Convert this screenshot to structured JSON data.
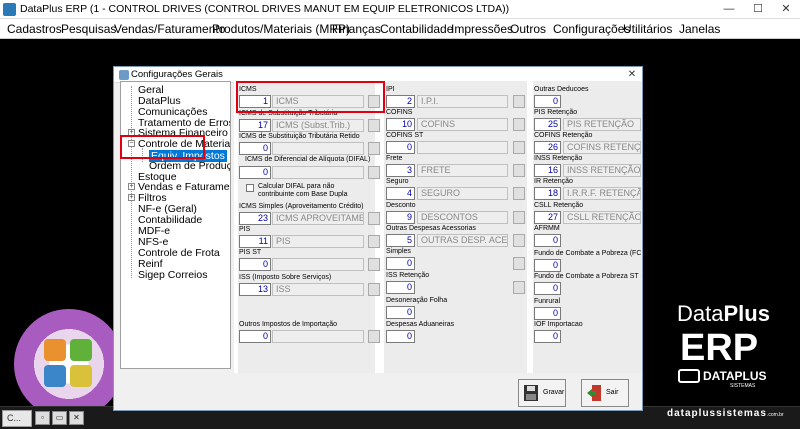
{
  "window": {
    "title": "DataPlus ERP (1 - CONTROL DRIVES  (CONTROL DRIVES MANUT EM EQUIP ELETRONICOS LTDA))",
    "controls": {
      "minimize": "—",
      "maximize": "☐",
      "close": "✕"
    }
  },
  "menu": [
    "Cadastros",
    "Pesquisas",
    "Vendas/Faturamento",
    "Produtos/Materiais (MRP)",
    "Finanças",
    "Contabilidade",
    "Impressões",
    "Outros",
    "Configurações",
    "Utilitários",
    "Janelas"
  ],
  "brand": {
    "name_part1": "Data",
    "name_part2": "Plus",
    "erp": "ERP",
    "logo_text": "DATAPLUS",
    "logo_subtext": "SISTEMAS",
    "website": "dataplussistemas",
    "website_suffix": ".com.br"
  },
  "taskbar": {
    "item": "C...",
    "btn1": "▫",
    "btn2": "▭",
    "btn3": "✕"
  },
  "dialog": {
    "title": "Configurações Gerais",
    "close": "✕",
    "tree": [
      "Geral",
      "DataPlus",
      "Comunicações",
      "Tratamento de Erros",
      "Sistema Financeiro",
      "Controle de Materiais",
      "Equiv. Impostos",
      "Ordem de Produção",
      "Estoque",
      "Vendas e Faturamento",
      "Filtros",
      "NF-e (Geral)",
      "Contabilidade",
      "MDF-e",
      "NFS-e",
      "Controle de Frota",
      "Reinf",
      "Sigep Correios"
    ],
    "tree_selected": "Equiv. Impostos",
    "col1": [
      {
        "label": "ICMS",
        "code": "1",
        "desc": "ICMS"
      },
      {
        "label": "ICMS de Substituição Tributária",
        "code": "17",
        "desc": "ICMS (Subst.Trib.)"
      },
      {
        "label": "ICMS de Substituição Tributária Retido",
        "code": "0",
        "desc": ""
      },
      {
        "label": "ICMS de Diferencial de Alíquota (DIFAL)",
        "code": "0",
        "desc": ""
      },
      {
        "label": "ICMS Simples (Aproveitamento Crédito)",
        "code": "23",
        "desc": "ICMS APROVEITAMENT"
      },
      {
        "label": "PIS",
        "code": "11",
        "desc": "PIS"
      },
      {
        "label": "PIS ST",
        "code": "0",
        "desc": ""
      },
      {
        "label": "ISS (Imposto Sobre Serviços)",
        "code": "13",
        "desc": "ISS"
      },
      {
        "label": "Outros Impostos de Importação",
        "code": "0",
        "desc": ""
      }
    ],
    "difal_checkbox": {
      "line1": "Calcular DIFAL para não",
      "line2": "contribuinte com Base Dupla"
    },
    "col2": [
      {
        "label": "IPI",
        "code": "2",
        "desc": "I.P.I."
      },
      {
        "label": "COFINS",
        "code": "10",
        "desc": "COFINS"
      },
      {
        "label": "COFINS ST",
        "code": "0",
        "desc": ""
      },
      {
        "label": "Frete",
        "code": "3",
        "desc": "FRETE"
      },
      {
        "label": "Seguro",
        "code": "4",
        "desc": "SEGURO"
      },
      {
        "label": "Desconto",
        "code": "9",
        "desc": "DESCONTOS"
      },
      {
        "label": "Outras Despesas Acessorias",
        "code": "5",
        "desc": "OUTRAS DESP. ACESS"
      },
      {
        "label": "Simples",
        "code": "0",
        "desc": ""
      },
      {
        "label": "ISS Retenção",
        "code": "0",
        "desc": ""
      },
      {
        "label": "Desoneração Folha",
        "code": "0",
        "desc": ""
      },
      {
        "label": "Despesas Aduaneiras",
        "code": "0",
        "desc": ""
      }
    ],
    "col3": [
      {
        "label": "Outras Deducoes",
        "code": "0",
        "desc": ""
      },
      {
        "label": "PIS Retenção",
        "code": "25",
        "desc": "PIS RETENÇÃO"
      },
      {
        "label": "COFINS Retenção",
        "code": "26",
        "desc": "COFINS RETENÇÃO"
      },
      {
        "label": "INSS Retenção",
        "code": "16",
        "desc": "INSS RETENÇÃO E"
      },
      {
        "label": "IR Retenção",
        "code": "18",
        "desc": "I.R.R.F. RETENÇÃO"
      },
      {
        "label": "CSLL Retenção",
        "code": "27",
        "desc": "CSLL RETENÇÃO"
      },
      {
        "label": "AFRMM",
        "code": "0",
        "desc": ""
      },
      {
        "label": "Fundo de Combate a Pobreza (FCP)",
        "code": "0",
        "desc": ""
      },
      {
        "label": "Fundo de Combate a Pobreza ST (R",
        "code": "0",
        "desc": ""
      },
      {
        "label": "Funrural",
        "code": "0",
        "desc": ""
      },
      {
        "label": "IOF Importacao",
        "code": "0",
        "desc": ""
      }
    ],
    "buttons": {
      "save": "Gravar",
      "exit": "Sair"
    },
    "colors": {
      "highlight": "#e00010",
      "selection": "#0078d7",
      "code_text": "#0000aa"
    }
  }
}
